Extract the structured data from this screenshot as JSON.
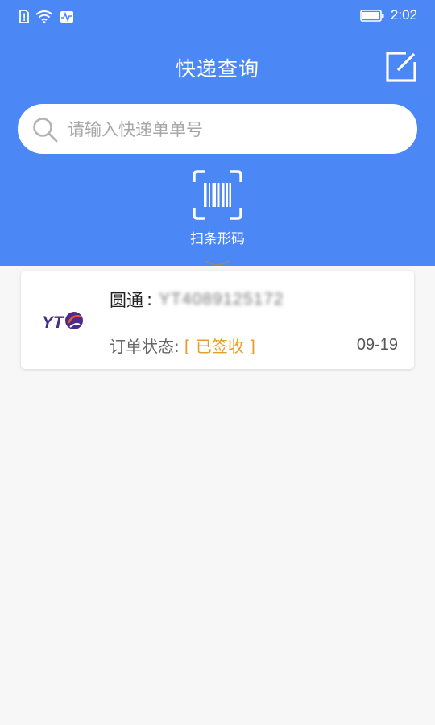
{
  "status_bar": {
    "time": "2:02"
  },
  "header": {
    "title": "快递查询",
    "edit_icon": "edit-square-icon"
  },
  "search": {
    "placeholder": "请输入快递单单号",
    "icon": "search-icon"
  },
  "scan": {
    "label": "扫条形码",
    "icon": "barcode-scan-icon"
  },
  "orders": [
    {
      "company": "圆通",
      "company_sep": ":",
      "tracking_no": "YT4089125172",
      "status_label": "订单状态:",
      "status": "[ 已签收 ]",
      "date": "09-19",
      "logo_text": "YT"
    }
  ],
  "colors": {
    "primary": "#4c87f6",
    "status": "#e89c29",
    "logo_yt": "#4b2c8a",
    "logo_accent": "#e8572a"
  }
}
